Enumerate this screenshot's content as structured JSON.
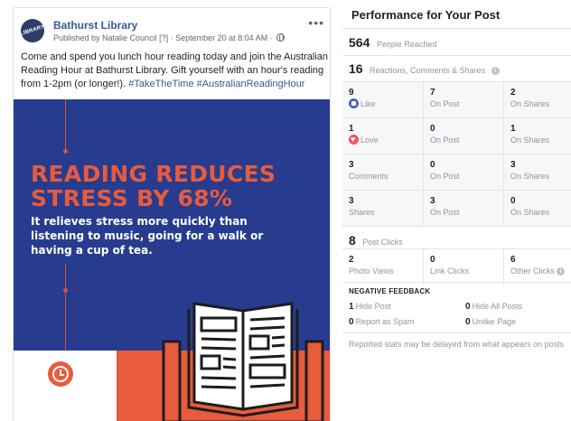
{
  "post": {
    "page_name": "Bathurst Library",
    "avatar_text": "LIBRARY",
    "meta_prefix": "Published by Natalie Council",
    "meta_help": "[?]",
    "meta_date": "· September 20 at 8:04 AM ·",
    "more_label": "•••",
    "body_text": "Come and spend you lunch hour reading today and join the Australian Reading Hour at Bathurst Library. Gift yourself with an hour's reading from 1-2pm (or longer!).",
    "hashtags": "#TakeTheTime #AustralianReadingHour",
    "image": {
      "headline_line1": "READING REDUCES",
      "headline_line2": "STRESS BY 68%",
      "subtext": "It relieves stress more quickly than listening to music, going for a walk or having a cup of tea.",
      "colors": {
        "background": "#273c8f",
        "accent": "#e85b3c",
        "text": "#ffffff"
      }
    }
  },
  "panel": {
    "title": "Performance for Your Post",
    "reached": {
      "value": "564",
      "label": "People Reached"
    },
    "engagement": {
      "value": "16",
      "label": "Reactions, Comments & Shares",
      "icon": "info-icon"
    },
    "rows": [
      {
        "c1": {
          "value": "9",
          "label": "Like",
          "icon": "like-icon"
        },
        "c2": {
          "value": "7",
          "label": "On Post"
        },
        "c3": {
          "value": "2",
          "label": "On Shares"
        }
      },
      {
        "c1": {
          "value": "1",
          "label": "Love",
          "icon": "love-icon"
        },
        "c2": {
          "value": "0",
          "label": "On Post"
        },
        "c3": {
          "value": "1",
          "label": "On Shares"
        }
      },
      {
        "c1": {
          "value": "3",
          "label": "Comments"
        },
        "c2": {
          "value": "0",
          "label": "On Post"
        },
        "c3": {
          "value": "3",
          "label": "On Shares"
        }
      },
      {
        "c1": {
          "value": "3",
          "label": "Shares"
        },
        "c2": {
          "value": "3",
          "label": "On Post"
        },
        "c3": {
          "value": "0",
          "label": "On Shares"
        }
      }
    ],
    "post_clicks": {
      "value": "8",
      "label": "Post Clicks"
    },
    "clicks": [
      {
        "value": "2",
        "label": "Photo Views"
      },
      {
        "value": "0",
        "label": "Link Clicks"
      },
      {
        "value": "6",
        "label": "Other Clicks"
      }
    ],
    "negative": {
      "title": "NEGATIVE FEEDBACK",
      "hide_post": {
        "value": "1",
        "label": "Hide Post"
      },
      "hide_all": {
        "value": "0",
        "label": "Hide All Posts"
      },
      "spam": {
        "value": "0",
        "label": "Report as Spam"
      },
      "unlike": {
        "value": "0",
        "label": "Unlike Page"
      }
    },
    "footnote": "Reported stats may be delayed from what appears on posts"
  }
}
